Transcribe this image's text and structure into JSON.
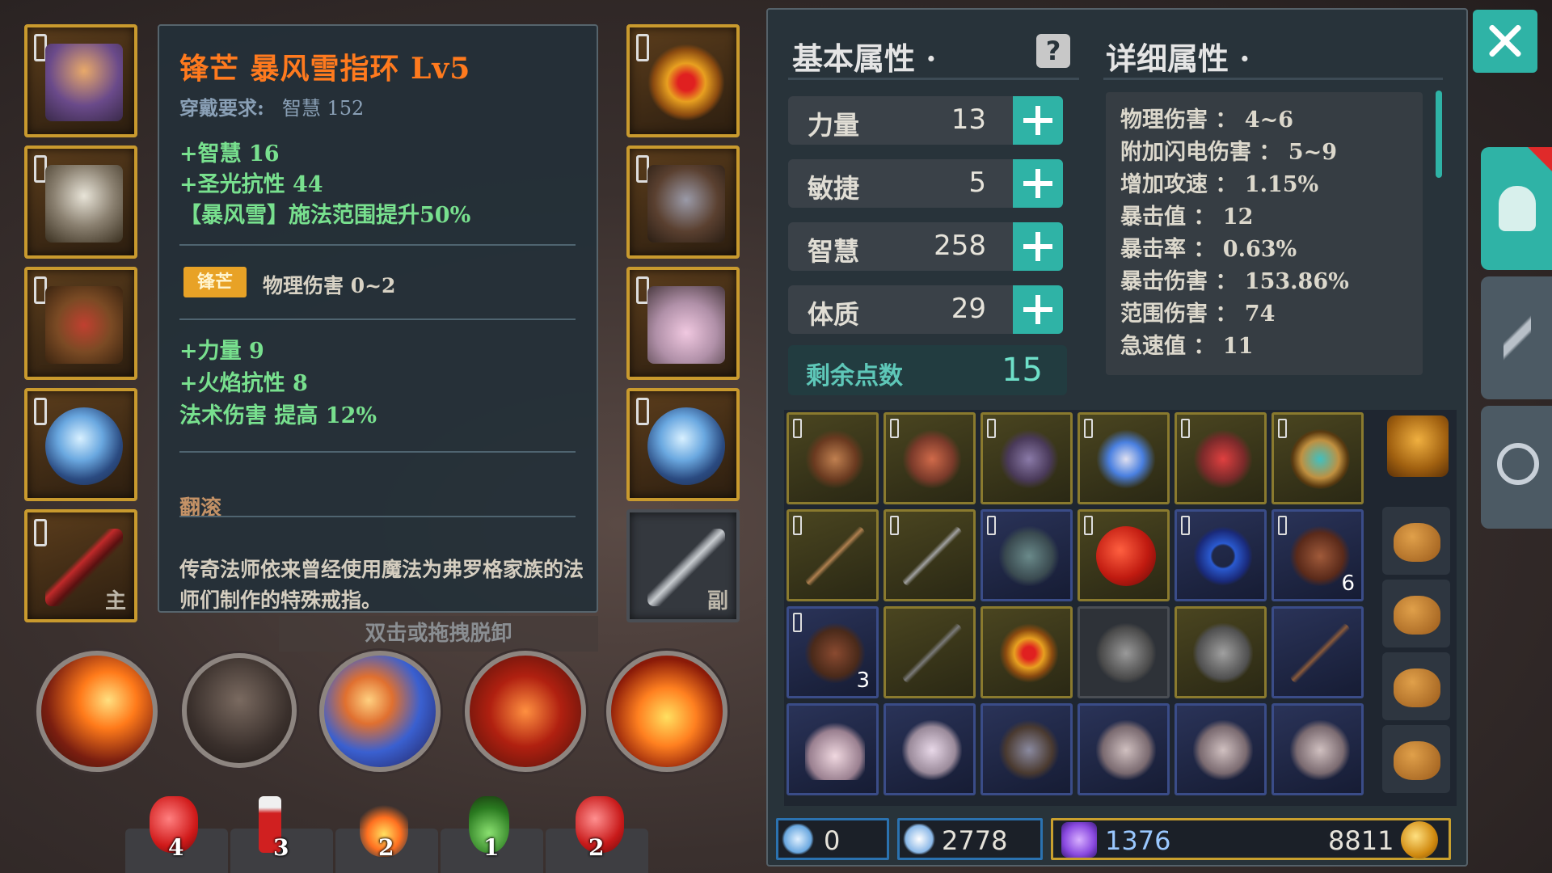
{
  "tooltip": {
    "title": "锋芒 暴风雪指环 Lv5",
    "req_label": "穿戴要求:",
    "req_value": "智慧 152",
    "bonus1": "+智慧 16",
    "bonus2": "+圣光抗性 44",
    "bonus3": "【暴风雪】施法范围提升50%",
    "badge": "锋芒",
    "phys": "物理伤害 0~2",
    "bonus4": "+力量 9",
    "bonus5": "+火焰抗性 8",
    "bonus6": "法术伤害 提高 12%",
    "sub": "翻滚",
    "desc": "传奇法师依来曾经使用魔法为弗罗格家族的法师们制作的特殊戒指。"
  },
  "hint": "双击或拖拽脱卸",
  "slots_left": [
    {
      "name": "helmet-slot",
      "tag": ""
    },
    {
      "name": "shoulder-slot",
      "tag": ""
    },
    {
      "name": "armor-slot",
      "tag": ""
    },
    {
      "name": "ring-slot-1",
      "tag": ""
    },
    {
      "name": "main-weapon-slot",
      "tag": "主"
    }
  ],
  "slots_right": [
    {
      "name": "amulet-slot",
      "tag": ""
    },
    {
      "name": "gloves-slot",
      "tag": ""
    },
    {
      "name": "boots-slot",
      "tag": ""
    },
    {
      "name": "ring-slot-2",
      "tag": ""
    },
    {
      "name": "offhand-slot",
      "tag": "副"
    }
  ],
  "potions": [
    "4",
    "3",
    "2",
    "1",
    "2"
  ],
  "panel": {
    "basic_header": "基本属性",
    "detail_header": "详细属性",
    "stats": [
      {
        "label": "力量",
        "value": "13"
      },
      {
        "label": "敏捷",
        "value": "5"
      },
      {
        "label": "智慧",
        "value": "258"
      },
      {
        "label": "体质",
        "value": "29"
      }
    ],
    "remain_label": "剩余点数",
    "remain_value": "15",
    "details": [
      "物理伤害 ： 4~6",
      "附加闪电伤害 ： 5~9",
      "增加攻速 ： 1.15%",
      "暴击值 ： 12",
      "暴击率 ： 0.63%",
      "暴击伤害 ： 153.86%",
      "范围伤害 ： 74",
      "急速值 ： 11"
    ]
  },
  "inventory_counts": {
    "r1c5": "6",
    "r2c0": "3"
  },
  "currency": {
    "crystal": "0",
    "soul": "2778",
    "gem": "1376",
    "gold": "8811"
  },
  "colors": {
    "accent": "#2fb3a6",
    "title": "#ff7a1e",
    "bonus": "#78e08e",
    "gold_border": "#c99a2e"
  }
}
